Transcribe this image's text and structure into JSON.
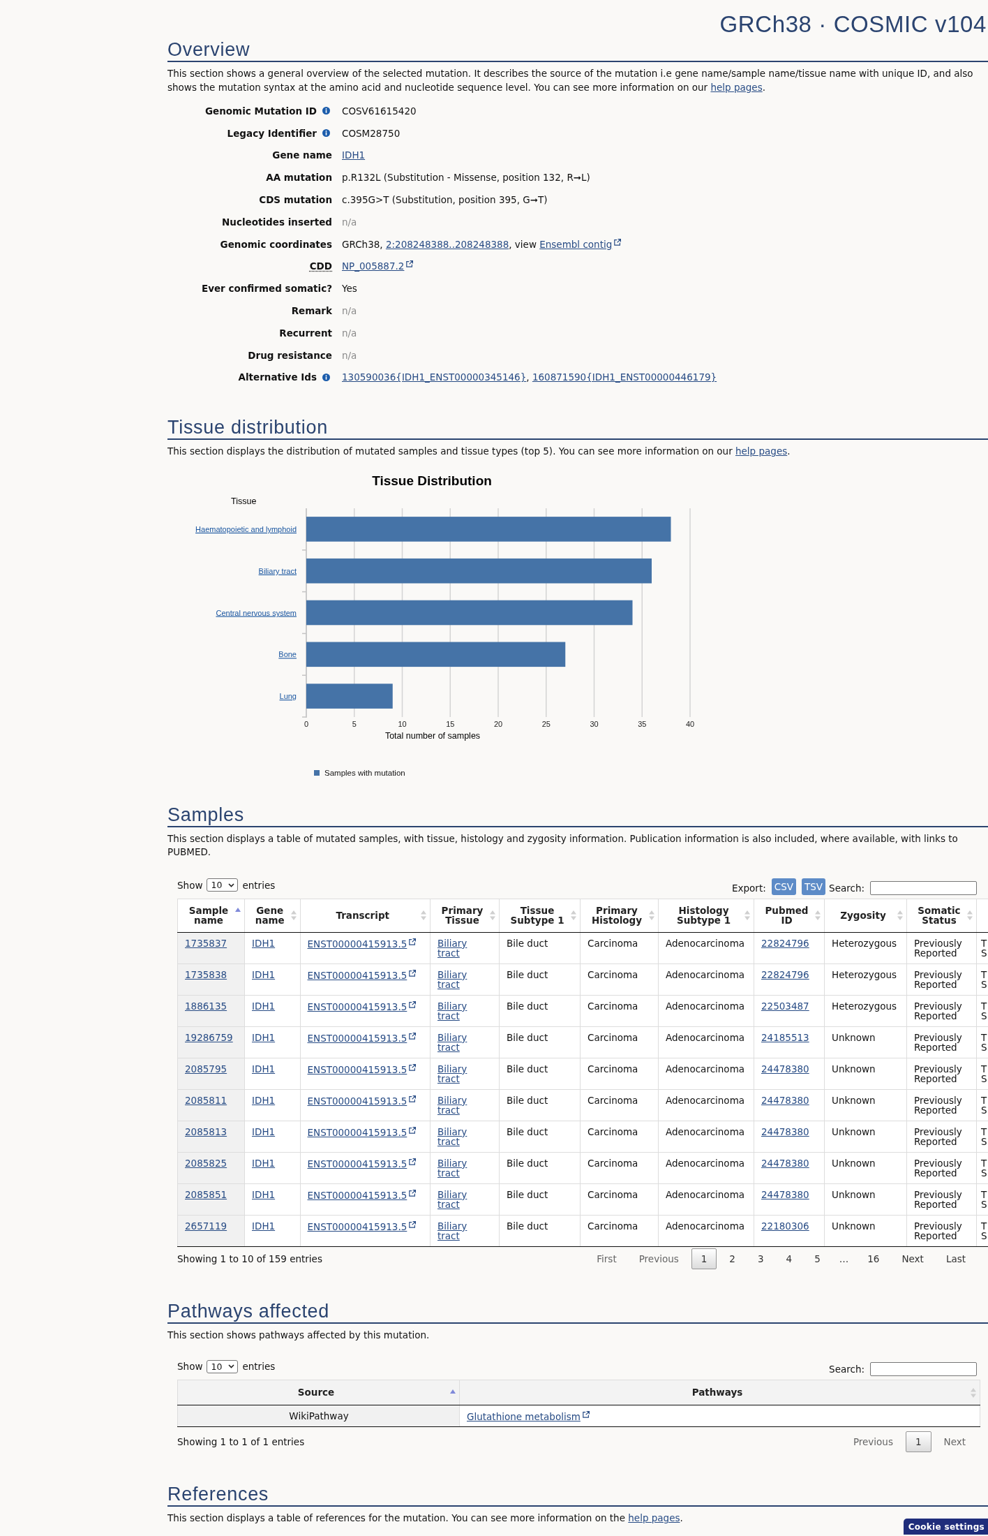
{
  "page_header": {
    "title": "GRCh38 · COSMIC v104"
  },
  "overview": {
    "heading": "Overview",
    "description": [
      {
        "kind": "text",
        "text": "This section shows a general overview of the selected mutation. It describes the source of the mutation i.e gene name/sample name/tissue name with unique ID, and also shows the mutation syntax at the amino acid and nucleotide sequence level. You can see more information on our "
      },
      {
        "kind": "link",
        "text": "help pages"
      },
      {
        "kind": "text",
        "text": "."
      }
    ],
    "fields": [
      {
        "label": "Genomic Mutation ID",
        "info": true,
        "abbreviation": false,
        "value": [
          {
            "kind": "text",
            "text": "COSV61615420"
          }
        ]
      },
      {
        "label": "Legacy Identifier",
        "info": true,
        "abbreviation": false,
        "value": [
          {
            "kind": "text",
            "text": "COSM28750"
          }
        ]
      },
      {
        "label": "Gene name",
        "info": false,
        "abbreviation": false,
        "value": [
          {
            "kind": "link",
            "text": "IDH1"
          }
        ]
      },
      {
        "label": "AA mutation",
        "info": false,
        "abbreviation": false,
        "value": [
          {
            "kind": "text",
            "text": "p.R132L (Substitution - Missense, position 132, R➞L)"
          }
        ]
      },
      {
        "label": "CDS mutation",
        "info": false,
        "abbreviation": false,
        "value": [
          {
            "kind": "text",
            "text": "c.395G>T (Substitution, position 395, G➞T)"
          }
        ]
      },
      {
        "label": "Nucleotides inserted",
        "info": false,
        "abbreviation": false,
        "value": [
          {
            "kind": "na",
            "text": "n/a"
          }
        ]
      },
      {
        "label": "Genomic coordinates",
        "info": false,
        "abbreviation": false,
        "value": [
          {
            "kind": "text",
            "text": "GRCh38, "
          },
          {
            "kind": "link",
            "text": "2:208248388..208248388"
          },
          {
            "kind": "text",
            "text": ", view "
          },
          {
            "kind": "external_link",
            "text": "Ensembl contig"
          }
        ]
      },
      {
        "label": "CDD",
        "info": false,
        "abbreviation": true,
        "value": [
          {
            "kind": "external_link",
            "text": "NP_005887.2"
          }
        ]
      },
      {
        "label": "Ever confirmed somatic?",
        "info": false,
        "abbreviation": false,
        "value": [
          {
            "kind": "text",
            "text": "Yes"
          }
        ]
      },
      {
        "label": "Remark",
        "info": false,
        "abbreviation": false,
        "value": [
          {
            "kind": "na",
            "text": "n/a"
          }
        ]
      },
      {
        "label": "Recurrent",
        "info": false,
        "abbreviation": false,
        "value": [
          {
            "kind": "na",
            "text": "n/a"
          }
        ]
      },
      {
        "label": "Drug resistance",
        "info": false,
        "abbreviation": false,
        "value": [
          {
            "kind": "na",
            "text": "n/a"
          }
        ]
      },
      {
        "label": "Alternative Ids",
        "info": true,
        "abbreviation": false,
        "value": [
          {
            "kind": "link",
            "text": "130590036{IDH1_ENST00000345146}"
          },
          {
            "kind": "text",
            "text": ", "
          },
          {
            "kind": "link",
            "text": "160871590{IDH1_ENST00000446179}"
          }
        ]
      }
    ]
  },
  "tissue_distribution": {
    "heading": "Tissue distribution",
    "description": [
      {
        "kind": "text",
        "text": "This section displays the distribution of mutated samples and tissue types (top 5). You can see more information on our "
      },
      {
        "kind": "link",
        "text": "help pages"
      },
      {
        "kind": "text",
        "text": "."
      }
    ],
    "chart_data": {
      "type": "bar",
      "orientation": "horizontal",
      "title": "Tissue Distribution",
      "xlabel": "Total number of samples",
      "ylabel": "Tissue",
      "categories": [
        "Haematopoietic and lymphoid",
        "Biliary tract",
        "Central nervous system",
        "Bone",
        "Lung"
      ],
      "series": [
        {
          "name": "Samples with mutation",
          "color": "#4573a7",
          "values": [
            38,
            36,
            34,
            27,
            9
          ]
        }
      ],
      "xlim": [
        0,
        40
      ],
      "xticks": [
        0,
        5,
        10,
        15,
        20,
        25,
        30,
        35,
        40
      ],
      "grid": true
    }
  },
  "samples": {
    "heading": "Samples",
    "description": [
      {
        "kind": "text",
        "text": "This section displays a table of mutated samples, with tissue, histology and zygosity information. Publication information is also included, where available, with links to PUBMED."
      }
    ],
    "length_menu": {
      "label_before": "Show",
      "value": "10",
      "label_after": "entries"
    },
    "export": {
      "label": "Export:",
      "buttons": [
        "CSV",
        "TSV"
      ]
    },
    "search": {
      "label": "Search:"
    },
    "table": {
      "columns": [
        {
          "label": "Sample name",
          "kind": "link",
          "sorted": true
        },
        {
          "label": "Gene name",
          "kind": "link",
          "sorted": false
        },
        {
          "label": "Transcript",
          "kind": "external_link",
          "sorted": false
        },
        {
          "label": "Primary Tissue",
          "kind": "link",
          "sorted": false
        },
        {
          "label": "Tissue Subtype 1",
          "kind": "text",
          "sorted": false
        },
        {
          "label": "Primary Histology",
          "kind": "text",
          "sorted": false
        },
        {
          "label": "Histology Subtype 1",
          "kind": "text",
          "sorted": false
        },
        {
          "label": "Pubmed ID",
          "kind": "link",
          "sorted": false
        },
        {
          "label": "Zygosity",
          "kind": "text",
          "sorted": false
        },
        {
          "label": "Somatic Status",
          "kind": "text",
          "sorted": false
        },
        {
          "kind": "text"
        }
      ],
      "rows": [
        {
          "cells": [
            "1735837",
            "IDH1",
            "ENST00000415913.5",
            "Biliary tract",
            "Bile duct",
            "Carcinoma",
            "Adenocarcinoma",
            "22824796",
            "Heterozygous",
            "Previously Reported",
            "T S"
          ]
        },
        {
          "cells": [
            "1735838",
            "IDH1",
            "ENST00000415913.5",
            "Biliary tract",
            "Bile duct",
            "Carcinoma",
            "Adenocarcinoma",
            "22824796",
            "Heterozygous",
            "Previously Reported",
            "T S"
          ]
        },
        {
          "cells": [
            "1886135",
            "IDH1",
            "ENST00000415913.5",
            "Biliary tract",
            "Bile duct",
            "Carcinoma",
            "Adenocarcinoma",
            "22503487",
            "Heterozygous",
            "Previously Reported",
            "T S"
          ]
        },
        {
          "cells": [
            "19286759",
            "IDH1",
            "ENST00000415913.5",
            "Biliary tract",
            "Bile duct",
            "Carcinoma",
            "Adenocarcinoma",
            "24185513",
            "Unknown",
            "Previously Reported",
            "T S"
          ]
        },
        {
          "cells": [
            "2085795",
            "IDH1",
            "ENST00000415913.5",
            "Biliary tract",
            "Bile duct",
            "Carcinoma",
            "Adenocarcinoma",
            "24478380",
            "Unknown",
            "Previously Reported",
            "T S"
          ]
        },
        {
          "cells": [
            "2085811",
            "IDH1",
            "ENST00000415913.5",
            "Biliary tract",
            "Bile duct",
            "Carcinoma",
            "Adenocarcinoma",
            "24478380",
            "Unknown",
            "Previously Reported",
            "T S"
          ]
        },
        {
          "cells": [
            "2085813",
            "IDH1",
            "ENST00000415913.5",
            "Biliary tract",
            "Bile duct",
            "Carcinoma",
            "Adenocarcinoma",
            "24478380",
            "Unknown",
            "Previously Reported",
            "T S"
          ]
        },
        {
          "cells": [
            "2085825",
            "IDH1",
            "ENST00000415913.5",
            "Biliary tract",
            "Bile duct",
            "Carcinoma",
            "Adenocarcinoma",
            "24478380",
            "Unknown",
            "Previously Reported",
            "T S"
          ]
        },
        {
          "cells": [
            "2085851",
            "IDH1",
            "ENST00000415913.5",
            "Biliary tract",
            "Bile duct",
            "Carcinoma",
            "Adenocarcinoma",
            "24478380",
            "Unknown",
            "Previously Reported",
            "T S"
          ]
        },
        {
          "cells": [
            "2657119",
            "IDH1",
            "ENST00000415913.5",
            "Biliary tract",
            "Bile duct",
            "Carcinoma",
            "Adenocarcinoma",
            "22180306",
            "Unknown",
            "Previously Reported",
            "T S"
          ]
        }
      ]
    },
    "info": "Showing 1 to 10 of 159 entries",
    "pagination": [
      {
        "label": "First",
        "kind": "button",
        "selected": false,
        "disabled": true
      },
      {
        "label": "Previous",
        "kind": "button",
        "selected": false,
        "disabled": true
      },
      {
        "label": "1",
        "kind": "button",
        "selected": true,
        "disabled": false
      },
      {
        "label": "2",
        "kind": "button",
        "selected": false,
        "disabled": false
      },
      {
        "label": "3",
        "kind": "button",
        "selected": false,
        "disabled": false
      },
      {
        "label": "4",
        "kind": "button",
        "selected": false,
        "disabled": false
      },
      {
        "label": "5",
        "kind": "button",
        "selected": false,
        "disabled": false
      },
      {
        "label": "…",
        "kind": "ellipsis",
        "selected": false,
        "disabled": false
      },
      {
        "label": "16",
        "kind": "button",
        "selected": false,
        "disabled": false
      },
      {
        "label": "Next",
        "kind": "button",
        "selected": false,
        "disabled": false
      },
      {
        "label": "Last",
        "kind": "button",
        "selected": false,
        "disabled": false
      }
    ]
  },
  "pathways": {
    "heading": "Pathways affected",
    "description": [
      {
        "kind": "text",
        "text": "This section shows pathways affected by this mutation."
      }
    ],
    "length_menu": {
      "label_before": "Show",
      "value": "10",
      "label_after": "entries"
    },
    "search": {
      "label": "Search:"
    },
    "table": {
      "columns": [
        {
          "label": "Source",
          "kind": "text",
          "sorted": true
        },
        {
          "label": "Pathways",
          "kind": "external_link",
          "sorted": false
        }
      ],
      "rows": [
        {
          "cells": [
            "WikiPathway",
            "Glutathione metabolism"
          ]
        }
      ]
    },
    "info": "Showing 1 to 1 of 1 entries",
    "pagination": [
      {
        "label": "Previous",
        "kind": "button",
        "selected": false,
        "disabled": true
      },
      {
        "label": "1",
        "kind": "button",
        "selected": true,
        "disabled": false
      },
      {
        "label": "Next",
        "kind": "button",
        "selected": false,
        "disabled": true
      }
    ]
  },
  "references": {
    "heading": "References",
    "description": [
      {
        "kind": "text",
        "text": "This section displays a table of references for the mutation. You can see more information on the "
      },
      {
        "kind": "link",
        "text": "help pages"
      },
      {
        "kind": "text",
        "text": "."
      }
    ]
  },
  "cookie_button": "Cookie settings"
}
